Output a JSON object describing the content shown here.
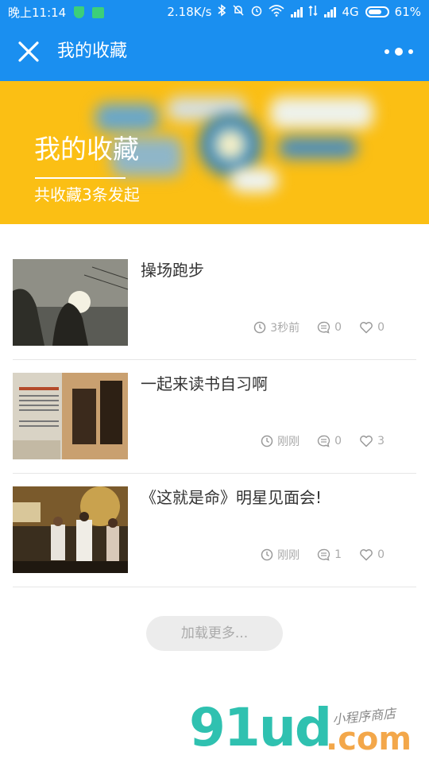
{
  "status_bar": {
    "time": "晚上11:14",
    "speed": "2.18K/s",
    "network": "4G",
    "battery": "61%"
  },
  "nav": {
    "title": "我的收藏"
  },
  "banner": {
    "title": "我的收藏",
    "subtitle": "共收藏3条发起"
  },
  "items": [
    {
      "title": "操场跑步",
      "time": "3秒前",
      "comments": "0",
      "likes": "0"
    },
    {
      "title": "一起来读书自习啊",
      "time": "刚刚",
      "comments": "0",
      "likes": "3"
    },
    {
      "title": "《这就是命》明星见面会!",
      "time": "刚刚",
      "comments": "1",
      "likes": "0"
    }
  ],
  "load_more": "加载更多...",
  "watermark": {
    "logo": "91ud",
    "domain": ".com",
    "tagline": "小程序商店"
  },
  "colors": {
    "primary": "#1a8ff0",
    "banner": "#fbbf14",
    "watermark_teal": "#2fc1b0",
    "watermark_orange": "#f3a74a"
  }
}
